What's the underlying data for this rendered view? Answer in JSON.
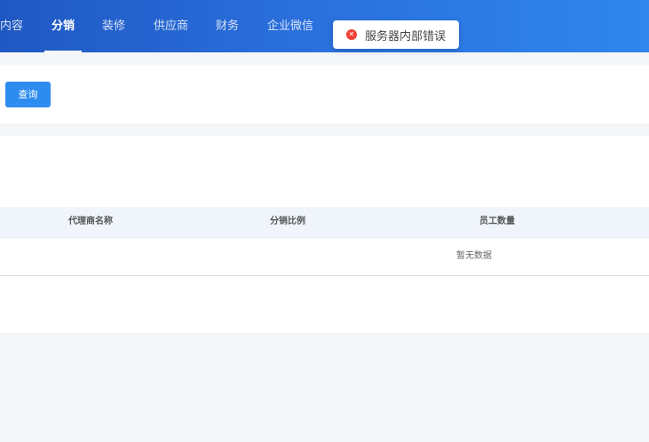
{
  "nav": {
    "items": [
      {
        "label": "内容",
        "active": false
      },
      {
        "label": "分销",
        "active": true
      },
      {
        "label": "装修",
        "active": false
      },
      {
        "label": "供应商",
        "active": false
      },
      {
        "label": "财务",
        "active": false
      },
      {
        "label": "企业微信",
        "active": false
      }
    ]
  },
  "toast": {
    "message": "服务器内部错误",
    "type": "error",
    "icon": "error-circle-icon"
  },
  "filter": {
    "query_label": "查询"
  },
  "table": {
    "columns": [
      "代理商名称",
      "分销比例",
      "员工数量"
    ],
    "empty_text": "暂无数据"
  },
  "colors": {
    "header_start": "#1f58c3",
    "header_end": "#2f86ec",
    "primary_button": "#2d8cf0",
    "error": "#f04134",
    "table_header_bg": "#f0f5fc"
  }
}
